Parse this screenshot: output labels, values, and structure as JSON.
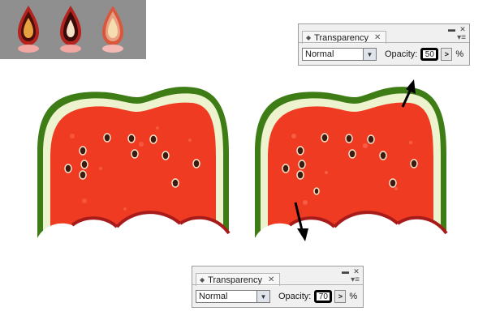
{
  "thumbnails": {
    "swatch_icons": [
      "dark-drop-icon",
      "dark-drop-icon",
      "light-drop-icon"
    ]
  },
  "panel_top": {
    "tab_label": "Transparency",
    "blend_mode": "Normal",
    "opacity_label": "Opacity:",
    "opacity_value": "50",
    "percent": "%"
  },
  "panel_bottom": {
    "tab_label": "Transparency",
    "blend_mode": "Normal",
    "opacity_label": "Opacity:",
    "opacity_value": "70",
    "percent": "%"
  },
  "colors": {
    "rind_outer": "#3e7d16",
    "rind_inner": "#eef3cf",
    "flesh": "#ef3b22",
    "bottom_edge": "#a81b1b",
    "thumb_bg": "#8f8f8f"
  }
}
